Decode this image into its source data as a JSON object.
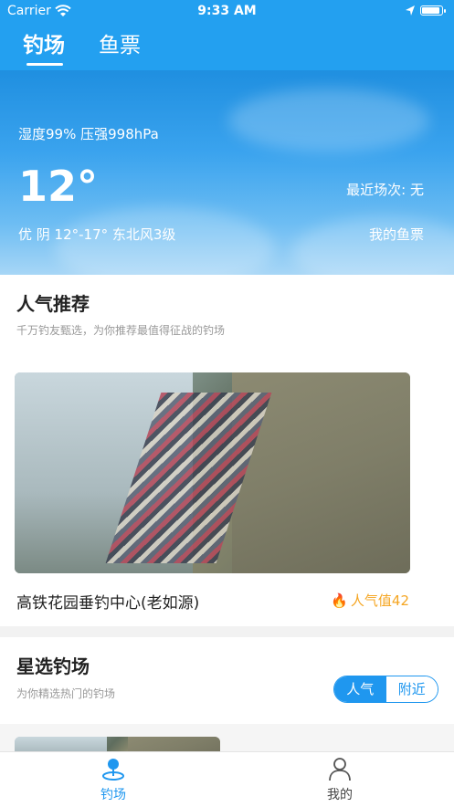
{
  "status_bar": {
    "carrier": "Carrier",
    "time": "9:33 AM"
  },
  "tabs": [
    {
      "label": "钓场",
      "active": true
    },
    {
      "label": "鱼票",
      "active": false
    }
  ],
  "weather": {
    "humidity_pressure": "湿度99% 压强998hPa",
    "temperature": "12°",
    "recent_sessions": "最近场次: 无",
    "condition": "优 阴 12°-17°  东北风3级",
    "my_tickets": "我的鱼票"
  },
  "popular": {
    "title": "人气推荐",
    "subtitle": "千万钓友甄选，为你推荐最值得征战的钓场",
    "spot_name": "高铁花园垂钓中心(老如源)",
    "popularity": "人气值42"
  },
  "featured": {
    "title": "星选钓场",
    "subtitle": "为你精选热门的钓场",
    "filters": [
      {
        "label": "人气",
        "active": true
      },
      {
        "label": "附近",
        "active": false
      }
    ]
  },
  "tab_bar": [
    {
      "label": "钓场",
      "icon": "fishing-spot-icon",
      "active": true
    },
    {
      "label": "我的",
      "icon": "profile-icon",
      "active": false
    }
  ],
  "colors": {
    "brand": "#23a0f0",
    "accent": "#1f97ef",
    "hot": "#f5a623",
    "flame": "#e8402a"
  }
}
